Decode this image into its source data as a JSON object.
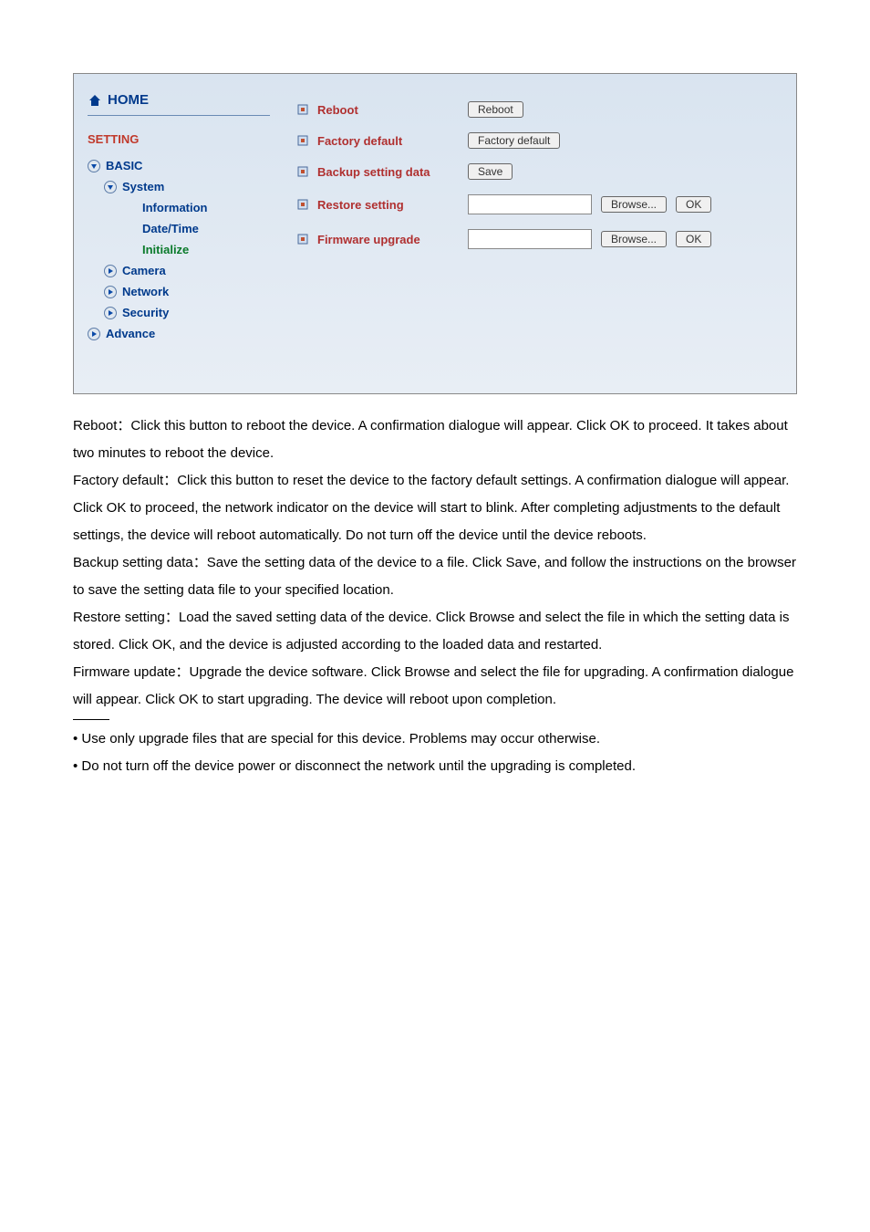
{
  "sidebar": {
    "home": "HOME",
    "setting": "SETTING",
    "basic": "BASIC",
    "system": "System",
    "information": "Information",
    "dateTime": "Date/Time",
    "initialize": "Initialize",
    "camera": "Camera",
    "network": "Network",
    "security": "Security",
    "advance": "Advance"
  },
  "content": {
    "reboot": {
      "label": "Reboot",
      "button": "Reboot"
    },
    "factoryDefault": {
      "label": "Factory default",
      "button": "Factory default"
    },
    "backupSettingData": {
      "label": "Backup setting data",
      "button": "Save"
    },
    "restoreSetting": {
      "label": "Restore setting",
      "browse": "Browse...",
      "ok": "OK"
    },
    "firmwareUpgrade": {
      "label": "Firmware upgrade",
      "browse": "Browse...",
      "ok": "OK"
    }
  },
  "doc": {
    "reboot": "Reboot：Click this button to reboot the device. A confirmation dialogue will appear. Click OK to proceed. It takes about two minutes to reboot the device.",
    "factoryDefault": "Factory default：Click this button to reset the device to the factory default settings. A confirmation dialogue will appear. Click OK to proceed, the network indicator on the device will start to blink. After completing adjustments to the default settings, the device will reboot automatically. Do not turn off the device until the device reboots.",
    "backup": "Backup setting data：Save the setting data of the device to a file. Click Save, and follow the instructions on the browser to save the setting data file to your specified location.",
    "restore": "Restore setting：Load the saved setting data of the device. Click Browse and select the file in which the setting data is stored. Click OK, and the device is adjusted according to the loaded data and restarted.",
    "firmware": "Firmware update：Upgrade the device software. Click Browse and select the file for upgrading. A confirmation dialogue will appear. Click OK to start upgrading. The device will reboot upon completion.",
    "note1": "• Use only upgrade files that are special for this device. Problems may occur otherwise.",
    "note2": "• Do not turn off the device power or disconnect the network until the upgrading is completed."
  }
}
